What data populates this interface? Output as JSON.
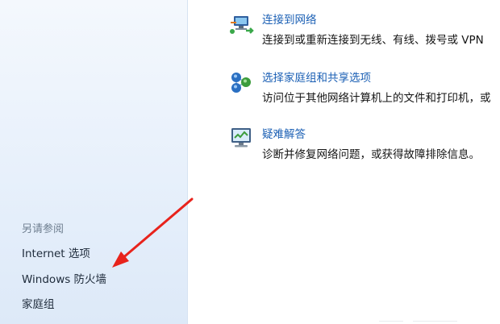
{
  "tasks": [
    {
      "title": "连接到网络",
      "description": "连接到或重新连接到无线、有线、拨号或 VPN",
      "icon": "network-connect-icon"
    },
    {
      "title": "选择家庭组和共享选项",
      "description": "访问位于其他网络计算机上的文件和打印机，或",
      "icon": "homegroup-icon"
    },
    {
      "title": "疑难解答",
      "description": "诊断并修复网络问题，或获得故障排除信息。",
      "icon": "troubleshoot-icon"
    }
  ],
  "sidebar": {
    "see_also_title": "另请参阅",
    "links": [
      {
        "label": "Internet 选项"
      },
      {
        "label": "Windows 防火墙"
      },
      {
        "label": "家庭组"
      }
    ]
  },
  "annotation": {
    "color": "#e8231c",
    "target": "Windows 防火墙"
  },
  "colors": {
    "link": "#1a5fb4",
    "sidebar_bg": "#e7f0fb",
    "text": "#141414"
  }
}
